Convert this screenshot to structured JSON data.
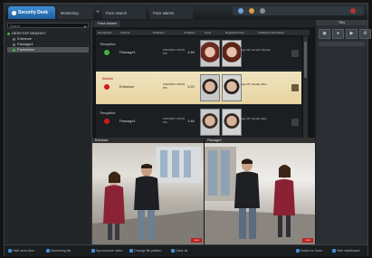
{
  "tabs": [
    {
      "label": "Security Desk",
      "active": true
    },
    {
      "label": "Monitoring",
      "active": false
    },
    {
      "label": "Face search",
      "active": false
    },
    {
      "label": "Face alarms",
      "active": false
    }
  ],
  "sidebar": {
    "search_placeholder": "Search",
    "items": [
      {
        "label": "DESKTOP-5RA/DEV",
        "color": "#45b045"
      },
      {
        "label": "Entrance",
        "color": "#777777"
      },
      {
        "label": "Passage1",
        "color": "#777777"
      },
      {
        "label": "FaceAlarm",
        "color": "#45b045",
        "selected": true
      }
    ]
  },
  "list": {
    "tab_label": "Face Alarms",
    "columns": [
      "Recognition",
      "Camera",
      "Date/time",
      "Similarity",
      "Tools",
      "Registered face",
      "Additional information"
    ],
    "rows": [
      {
        "status": "Recognition",
        "led": "#3fb83f",
        "name": "Passage1",
        "datetime": "2/11/2016 1:56:03 PM",
        "sim": "1:46",
        "info": "Age 38 | Gender Woman",
        "alert": false
      },
      {
        "status": "Blacklist",
        "led": "#d01818",
        "name": "Entrance",
        "datetime": "2/11/2016 1:56:03 PM",
        "sim": "1:22",
        "info": "Age 35 | Gender Man",
        "alert": true
      },
      {
        "status": "Recognition",
        "led": "#d01818",
        "name": "Passage1",
        "datetime": "2/11/2016 1:56:03 PM",
        "sim": "1:46",
        "info": "Age 38 | Gender Man",
        "alert": false
      }
    ]
  },
  "videos": [
    {
      "label": "Entrance",
      "rec": "Live"
    },
    {
      "label": "Passage1",
      "rec": "Live"
    }
  ],
  "right_panel": {
    "title": "Tiles"
  },
  "statusbar": [
    {
      "label": "Hide area view"
    },
    {
      "label": "Monitoring list"
    },
    {
      "label": "Synchronize video"
    },
    {
      "label": "Change tile pattern"
    },
    {
      "label": "Clear all"
    },
    {
      "label": "Switch to Tools"
    },
    {
      "label": "Hide dashboard"
    }
  ]
}
